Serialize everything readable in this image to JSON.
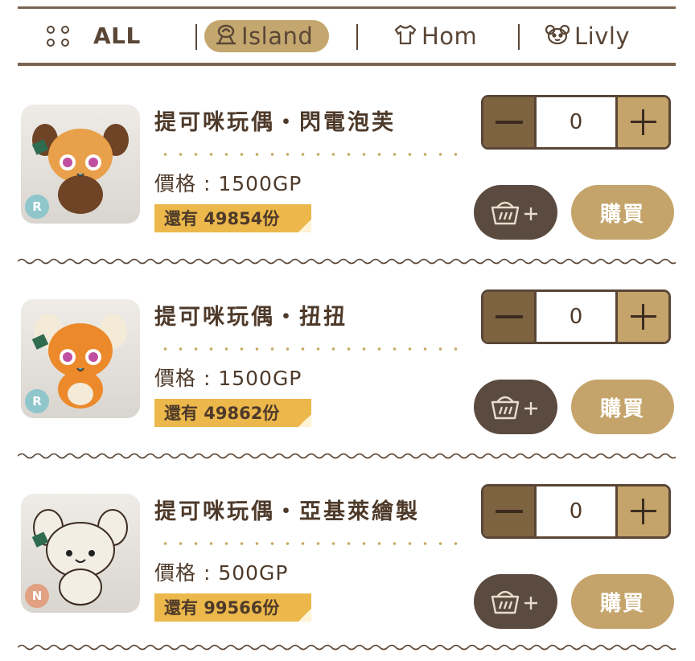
{
  "tabs": [
    {
      "label": "ALL",
      "icon": "grid-dots-icon",
      "active": false
    },
    {
      "label": "Island",
      "icon": "island-icon",
      "active": true
    },
    {
      "label": "Hom",
      "icon": "shirt-icon",
      "active": false
    },
    {
      "label": "Livly",
      "icon": "livly-face-icon",
      "active": false
    }
  ],
  "products": [
    {
      "name": "提可咪玩偶・閃電泡芙",
      "price": "價格 : 1500GP",
      "stock": "還有 49854份",
      "rarity": "R",
      "quantity": "0",
      "buy_label": "購買",
      "body_color": "#e9a04a",
      "ear_color": "#6e4326"
    },
    {
      "name": "提可咪玩偶・扭扭",
      "price": "價格 : 1500GP",
      "stock": "還有 49862份",
      "rarity": "R",
      "quantity": "0",
      "buy_label": "購買",
      "body_color": "#ec8a2b",
      "ear_color": "#f3ead8"
    },
    {
      "name": "提可咪玩偶・亞基萊繪製",
      "price": "價格 : 500GP",
      "stock": "還有 99566份",
      "rarity": "N",
      "quantity": "0",
      "buy_label": "購買",
      "body_color": "#f2eee4",
      "ear_color": "#f2eee4"
    }
  ],
  "colors": {
    "accent": "#c4a46a",
    "dark": "#5a4636",
    "stock_tag": "#ecb84b"
  }
}
